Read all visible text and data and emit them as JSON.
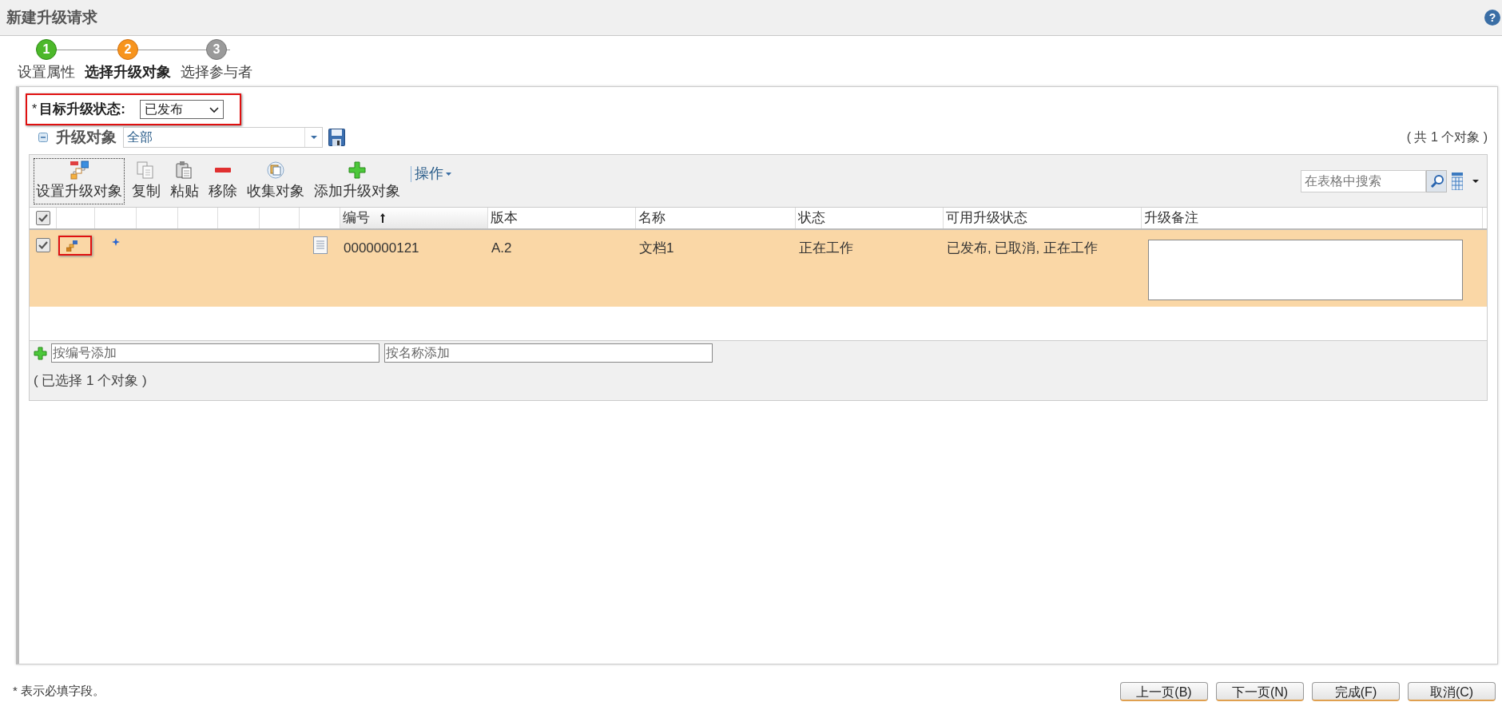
{
  "window": {
    "title": "新建升级请求",
    "help": "?"
  },
  "steps": [
    {
      "number": "1",
      "label": "设置属性",
      "completed": true,
      "selected": false
    },
    {
      "number": "2",
      "label": "选择升级对象",
      "selected": true
    },
    {
      "number": "3",
      "label": "选择参与者",
      "completed": false,
      "selected": false
    }
  ],
  "target_state": {
    "required_mark": "*",
    "label": "目标升级状态:",
    "value": "已发布",
    "annotated": true
  },
  "objects_section": {
    "title": "升级对象",
    "expanded": true,
    "filter": "全部",
    "count": "( 共 1 个对象 )"
  },
  "toolbar": {
    "buttons": [
      {
        "kind": "set",
        "label": "设置升级对象",
        "focused": true
      },
      {
        "kind": "copy",
        "label": "复制",
        "focused": false
      },
      {
        "kind": "paste",
        "label": "粘贴",
        "focused": false
      },
      {
        "kind": "remove",
        "label": "移除",
        "focused": false
      },
      {
        "kind": "collect",
        "label": "收集对象",
        "focused": false
      },
      {
        "kind": "add",
        "label": "添加升级对象",
        "focused": false
      }
    ],
    "menu": "操作",
    "search": {
      "placeholder": "在表格中搜索"
    }
  },
  "table": {
    "all_checked": true,
    "columns": [
      {
        "label": "编号",
        "sorted": true
      },
      {
        "label": "版本",
        "sorted": false
      },
      {
        "label": "名称",
        "sorted": false
      },
      {
        "label": "状态",
        "sorted": false
      },
      {
        "label": "可用升级状态",
        "sorted": false
      },
      {
        "label": "升级备注",
        "sorted": false
      }
    ],
    "rows": [
      {
        "checked": true,
        "selected": true,
        "icon_annotated": true,
        "cells": [
          "0000000121",
          "A.2",
          "文档1",
          "正在工作",
          "已发布, 已取消, 正在工作"
        ]
      }
    ]
  },
  "add_row": {
    "by_number_placeholder": "按编号添加",
    "by_name_placeholder": "按名称添加"
  },
  "selection_status": "( 已选择 1 个对象 )",
  "footer": {
    "note": "* 表示必填字段。",
    "buttons": [
      "上一页(B)",
      "下一页(N)",
      "完成(F)",
      "取消(C)"
    ]
  }
}
